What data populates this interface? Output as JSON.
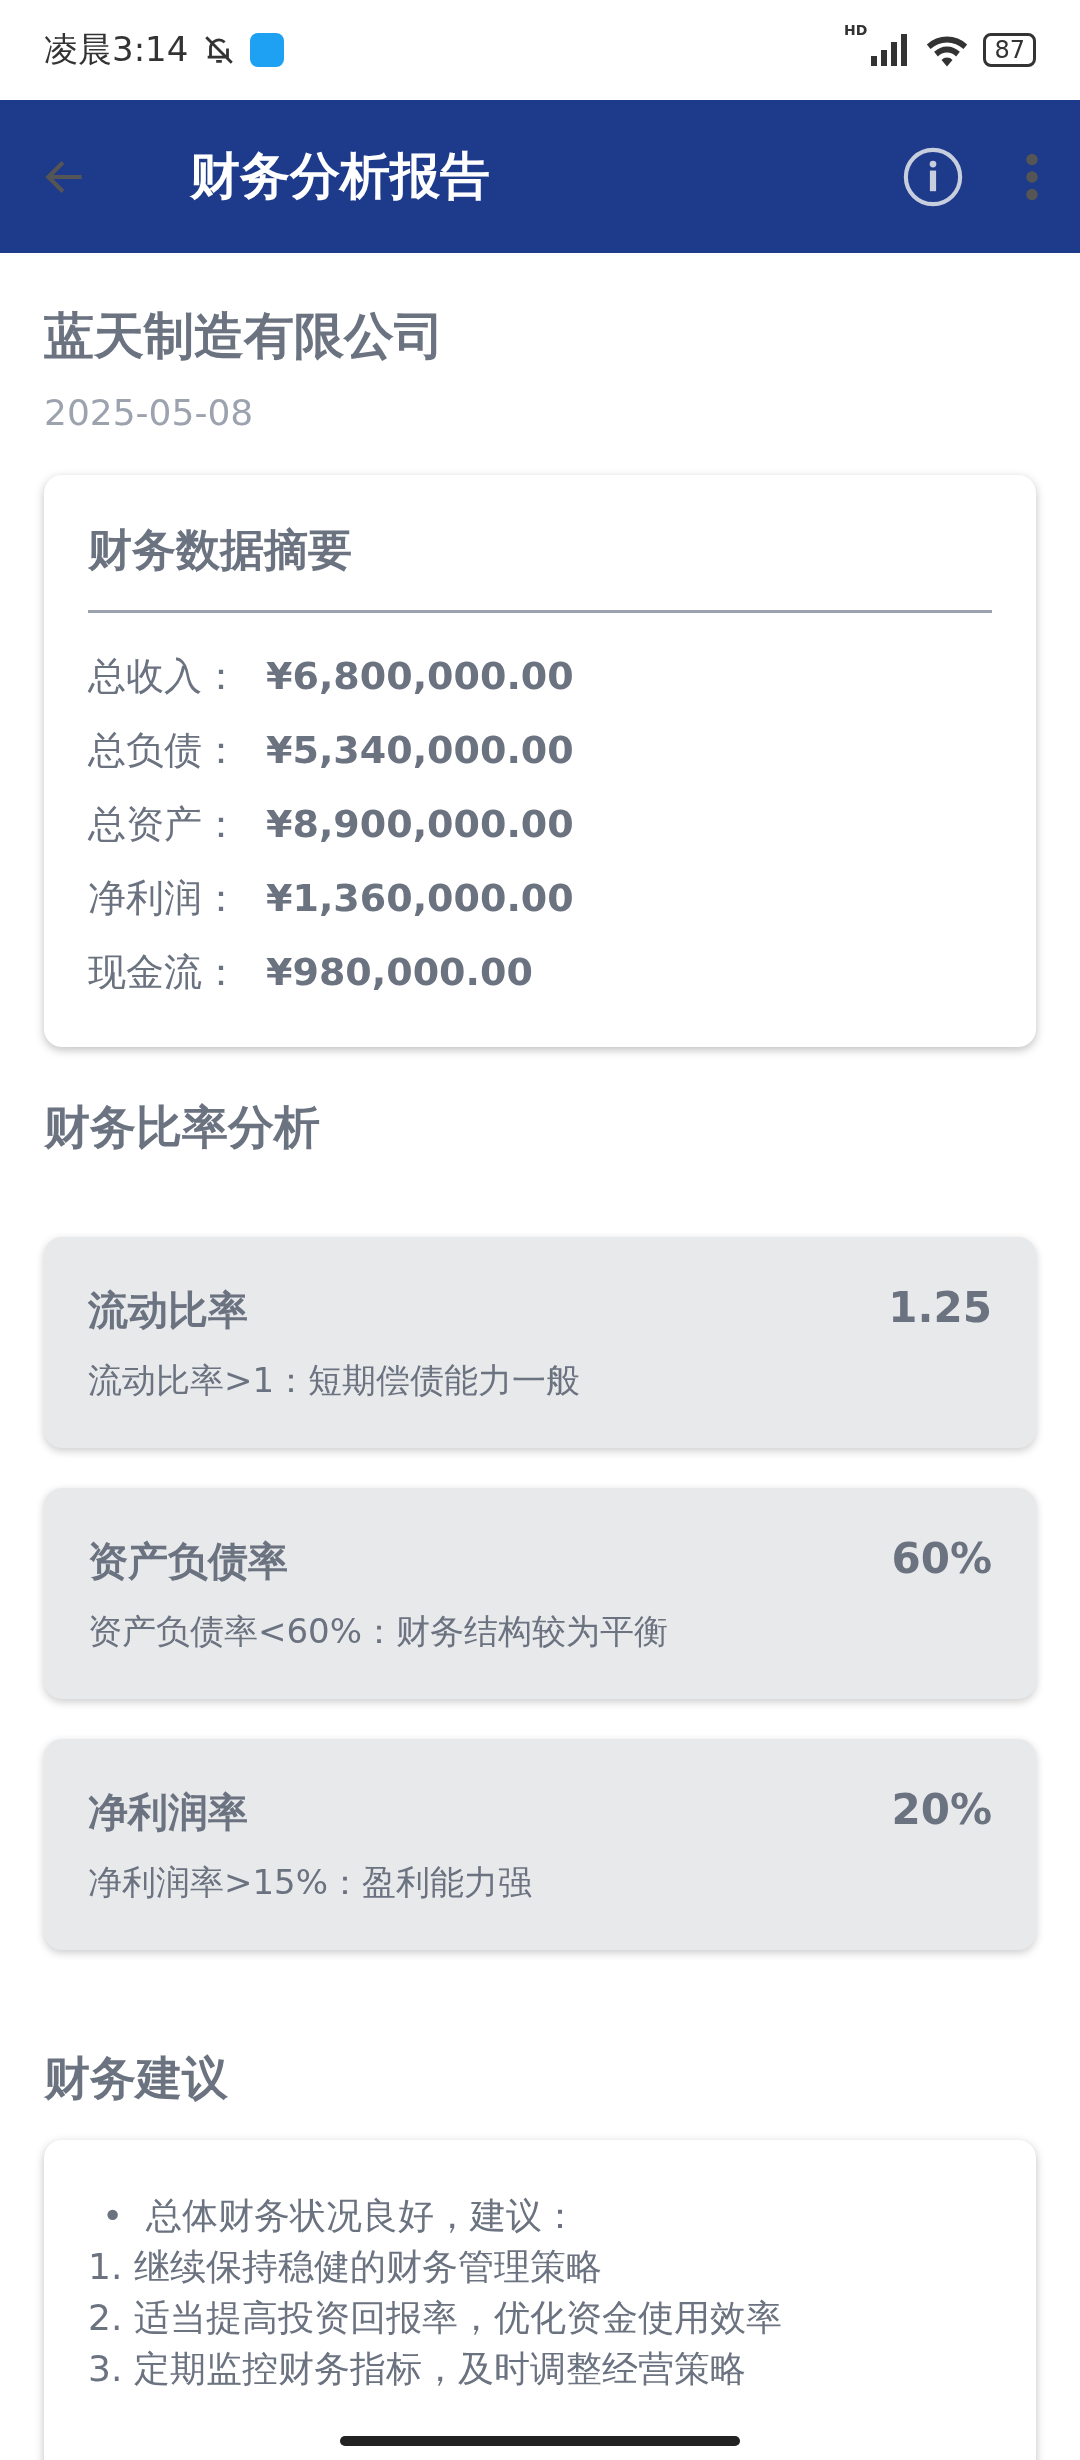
{
  "status_bar": {
    "time": "凌晨3:14",
    "battery": "87",
    "network": "HD"
  },
  "app_bar": {
    "title": "财务分析报告"
  },
  "company": {
    "name": "蓝天制造有限公司",
    "date": "2025-05-08"
  },
  "summary": {
    "title": "财务数据摘要",
    "rows": [
      {
        "label": "总收入：",
        "value": "¥6,800,000.00"
      },
      {
        "label": "总负债：",
        "value": "¥5,340,000.00"
      },
      {
        "label": "总资产：",
        "value": "¥8,900,000.00"
      },
      {
        "label": "净利润：",
        "value": "¥1,360,000.00"
      },
      {
        "label": "现金流：",
        "value": "¥980,000.00"
      }
    ]
  },
  "ratios": {
    "title": "财务比率分析",
    "items": [
      {
        "name": "流动比率",
        "value": "1.25",
        "note": "流动比率>1：短期偿债能力一般"
      },
      {
        "name": "资产负债率",
        "value": "60%",
        "note": "资产负债率<60%：财务结构较为平衡"
      },
      {
        "name": "净利润率",
        "value": "20%",
        "note": "净利润率>15%：盈利能力强"
      }
    ]
  },
  "advice": {
    "title": "财务建议",
    "bullet": "•",
    "lines": [
      "总体财务状况良好，建议：",
      "1. 继续保持稳健的财务管理策略",
      "2. 适当提高投资回报率，优化资金使用效率",
      "3. 定期监控财务指标，及时调整经营策略"
    ]
  }
}
